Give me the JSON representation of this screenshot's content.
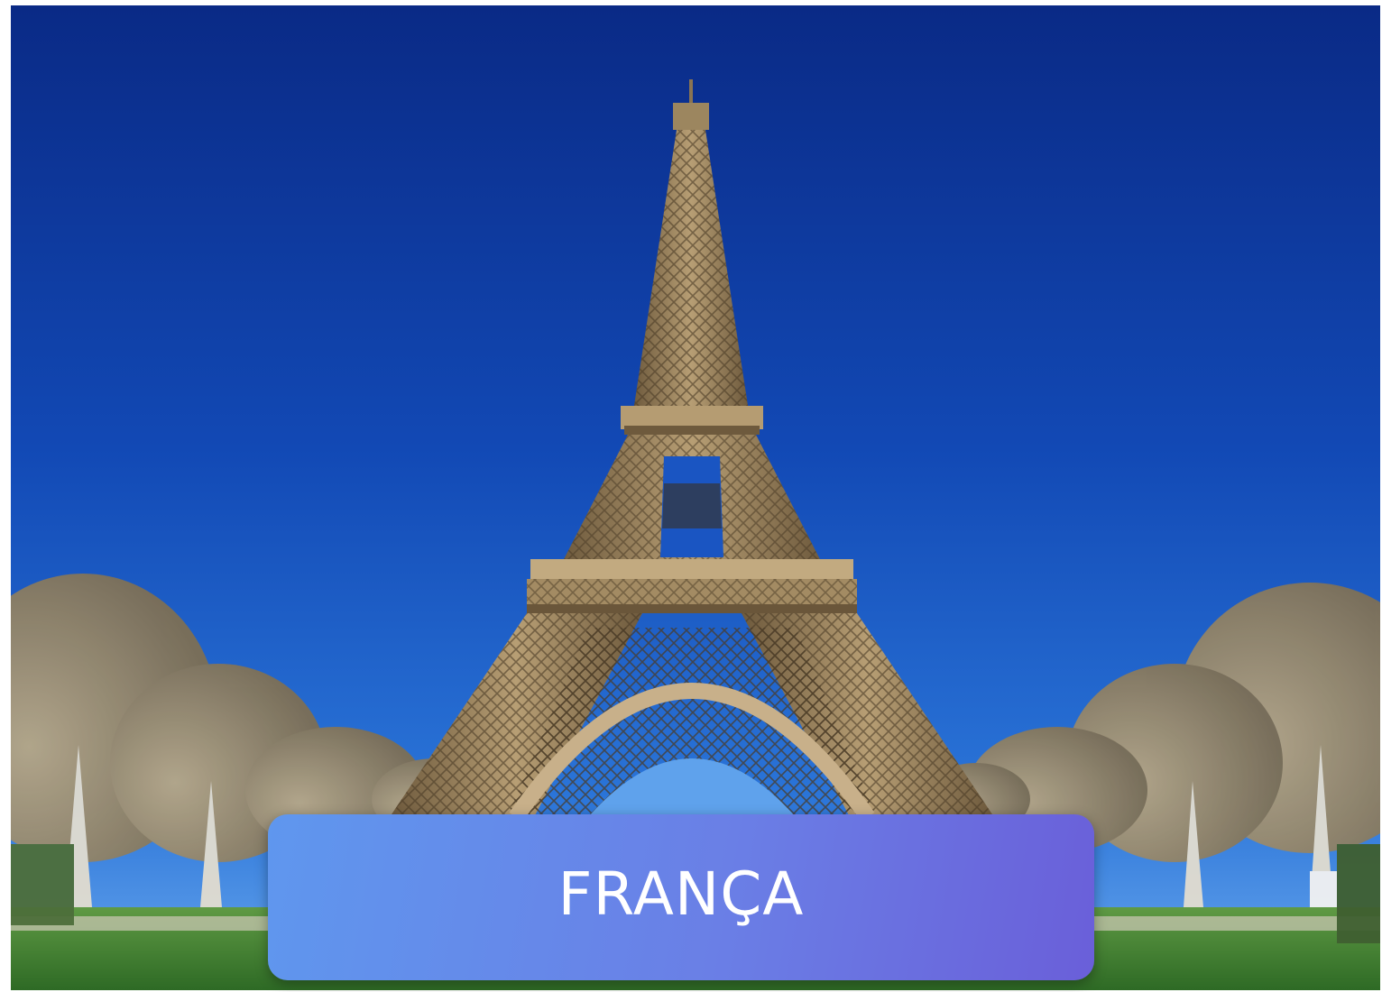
{
  "caption": {
    "label": "FRANÇA"
  },
  "photo": {
    "subject_icon": "eiffel-tower-photo",
    "colors": {
      "sky_top": "#0b2f8f",
      "sky_mid": "#1352c0",
      "sky_bottom": "#2c7fe0",
      "tower": "#8a7452",
      "tower_light": "#c9b48e",
      "trees": "#a39474",
      "grass": "#4e8a3a"
    }
  },
  "caption_colors": {
    "start": "#5f97ee",
    "end": "#6a5fd9",
    "text": "#ffffff"
  }
}
